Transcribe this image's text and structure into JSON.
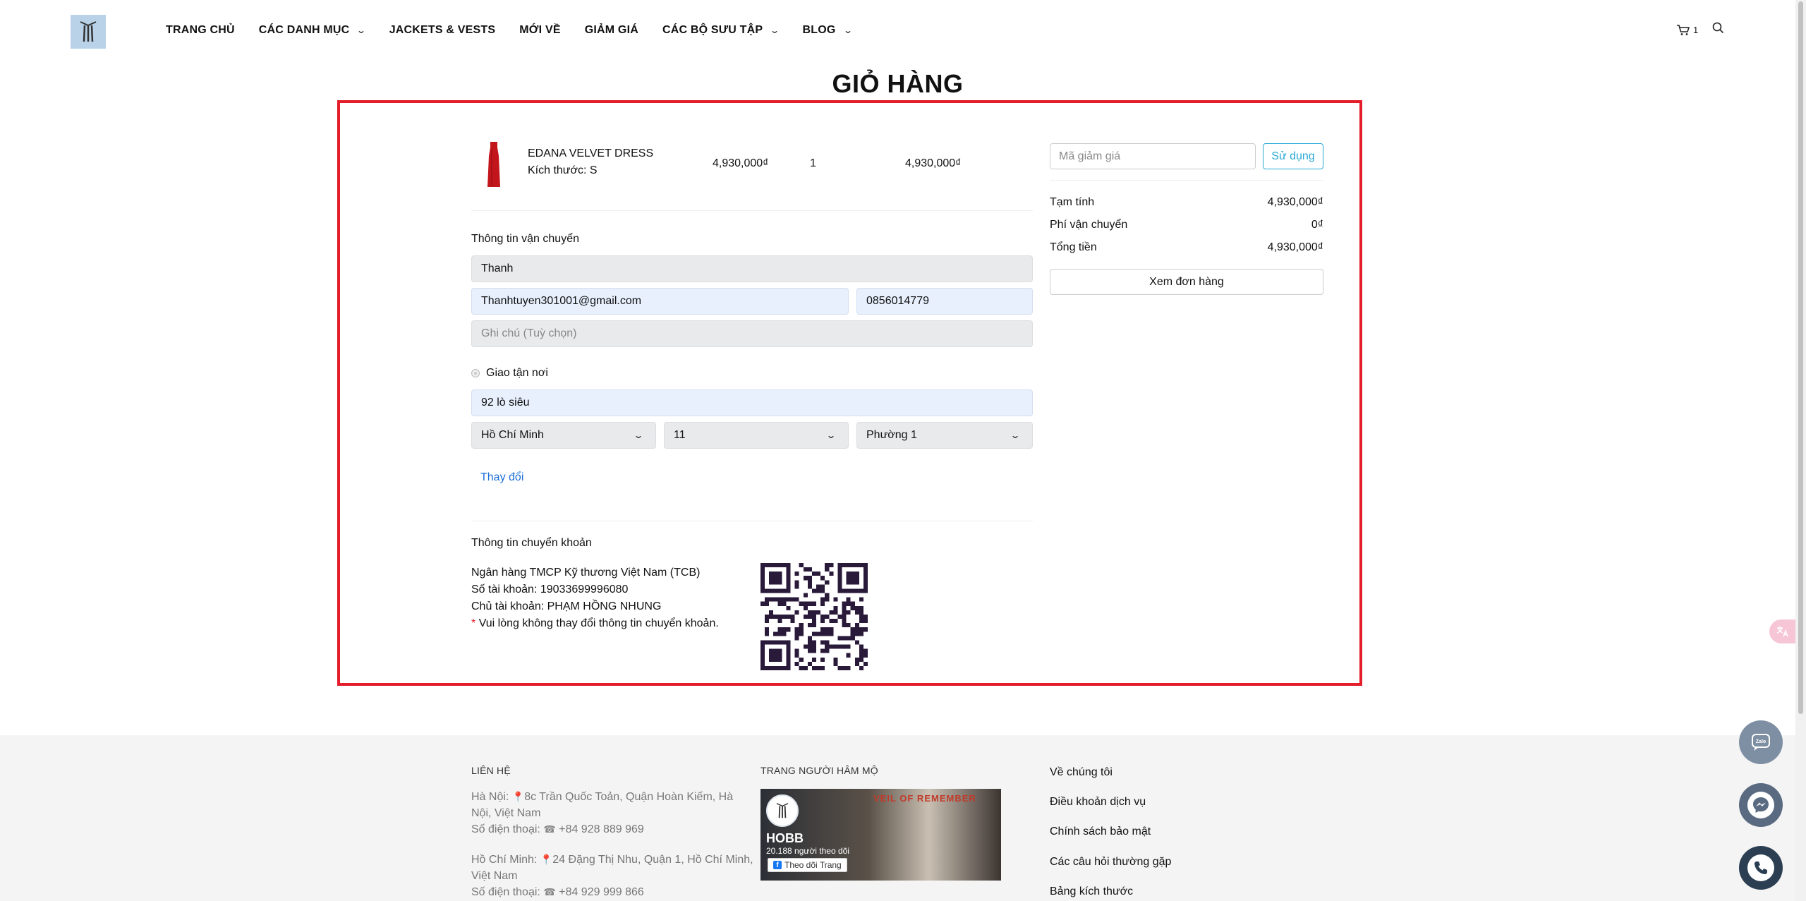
{
  "nav": {
    "items": [
      {
        "label": "TRANG CHỦ"
      },
      {
        "label": "CÁC DANH MỤC"
      },
      {
        "label": "JACKETS & VESTS"
      },
      {
        "label": "MỚI VỀ"
      },
      {
        "label": "GIẢM GIÁ"
      },
      {
        "label": "CÁC BỘ SƯU TẬP"
      },
      {
        "label": "BLOG"
      }
    ],
    "cart_count": "1"
  },
  "page_title": "GIỎ HÀNG",
  "cart_item": {
    "name": "EDANA VELVET DRESS",
    "size": "Kích thước: S",
    "price": "4,930,000₫",
    "quantity": "1",
    "total": "4,930,000₫"
  },
  "shipping": {
    "section_label": "Thông tin vận chuyển",
    "name_value": "Thanh",
    "email_value": "Thanhtuyen301001@gmail.com",
    "phone_value": "0856014779",
    "note_placeholder": "Ghi chú (Tuỳ chọn)",
    "delivery_option": "Giao tận nơi",
    "address_value": "92 lò siêu",
    "city_value": "Hồ Chí Minh",
    "district_value": "11",
    "ward_value": "Phường 1",
    "change_link": "Thay đổi"
  },
  "transfer": {
    "section_label": "Thông tin chuyển khoản",
    "bank": "Ngân hàng TMCP Kỹ thương Việt Nam (TCB)",
    "account_number": "Số tài khoản: 19033699996080",
    "account_owner": "Chủ tài khoản: PHẠM HỒNG NHUNG",
    "required_mark": "*",
    "warning": "Vui lòng không thay đổi thông tin chuyển khoản."
  },
  "summary": {
    "coupon_placeholder": "Mã giảm giá",
    "coupon_button": "Sử dụng",
    "subtotal_label": "Tạm tính",
    "subtotal_value": "4,930,000₫",
    "shipping_label": "Phí vận chuyển",
    "shipping_value": "0₫",
    "total_label": "Tổng tiền",
    "total_value": "4,930,000₫",
    "view_order_button": "Xem đơn hàng"
  },
  "footer": {
    "contact_heading": "LIÊN HỆ",
    "hanoi_address_label": "Hà Nội:",
    "hanoi_address": "8c Trần Quốc Toản, Quận Hoàn Kiếm, Hà Nội, Việt Nam",
    "hanoi_phone_label": "Số điện thoại:",
    "hanoi_phone": "+84 928 889 969",
    "hcm_address_label": "Hồ Chí Minh:",
    "hcm_address": "24 Đặng Thị Nhu, Quận 1, Hồ Chí Minh, Việt Nam",
    "hcm_phone_label": "Số điện thoại:",
    "hcm_phone": "+84 929 999 866",
    "fanpage_heading": "TRANG NGƯỜI HÂM MỘ",
    "fb_name": "HOBB",
    "fb_followers": "20.188 người theo dõi",
    "fb_follow_button": "Theo dõi Trang",
    "fb_banner_text": "VEIL OF REMEMBER",
    "links": [
      {
        "label": "Về chúng tôi"
      },
      {
        "label": "Điều khoản dịch vụ"
      },
      {
        "label": "Chính sách bảo mật"
      },
      {
        "label": "Các câu hỏi thường gặp"
      },
      {
        "label": "Bảng kích thước"
      }
    ]
  },
  "colors": {
    "highlight_outline": "#e31d2a",
    "accent_blue": "#29a9d4",
    "link_blue": "#1d6fd6",
    "input_autofill": "#e8f0fe"
  },
  "icons": {
    "cart": "cart-icon",
    "search": "search-icon",
    "zalo": "zalo-icon",
    "messenger": "messenger-icon",
    "phone": "phone-icon",
    "translate": "translate-icon"
  }
}
